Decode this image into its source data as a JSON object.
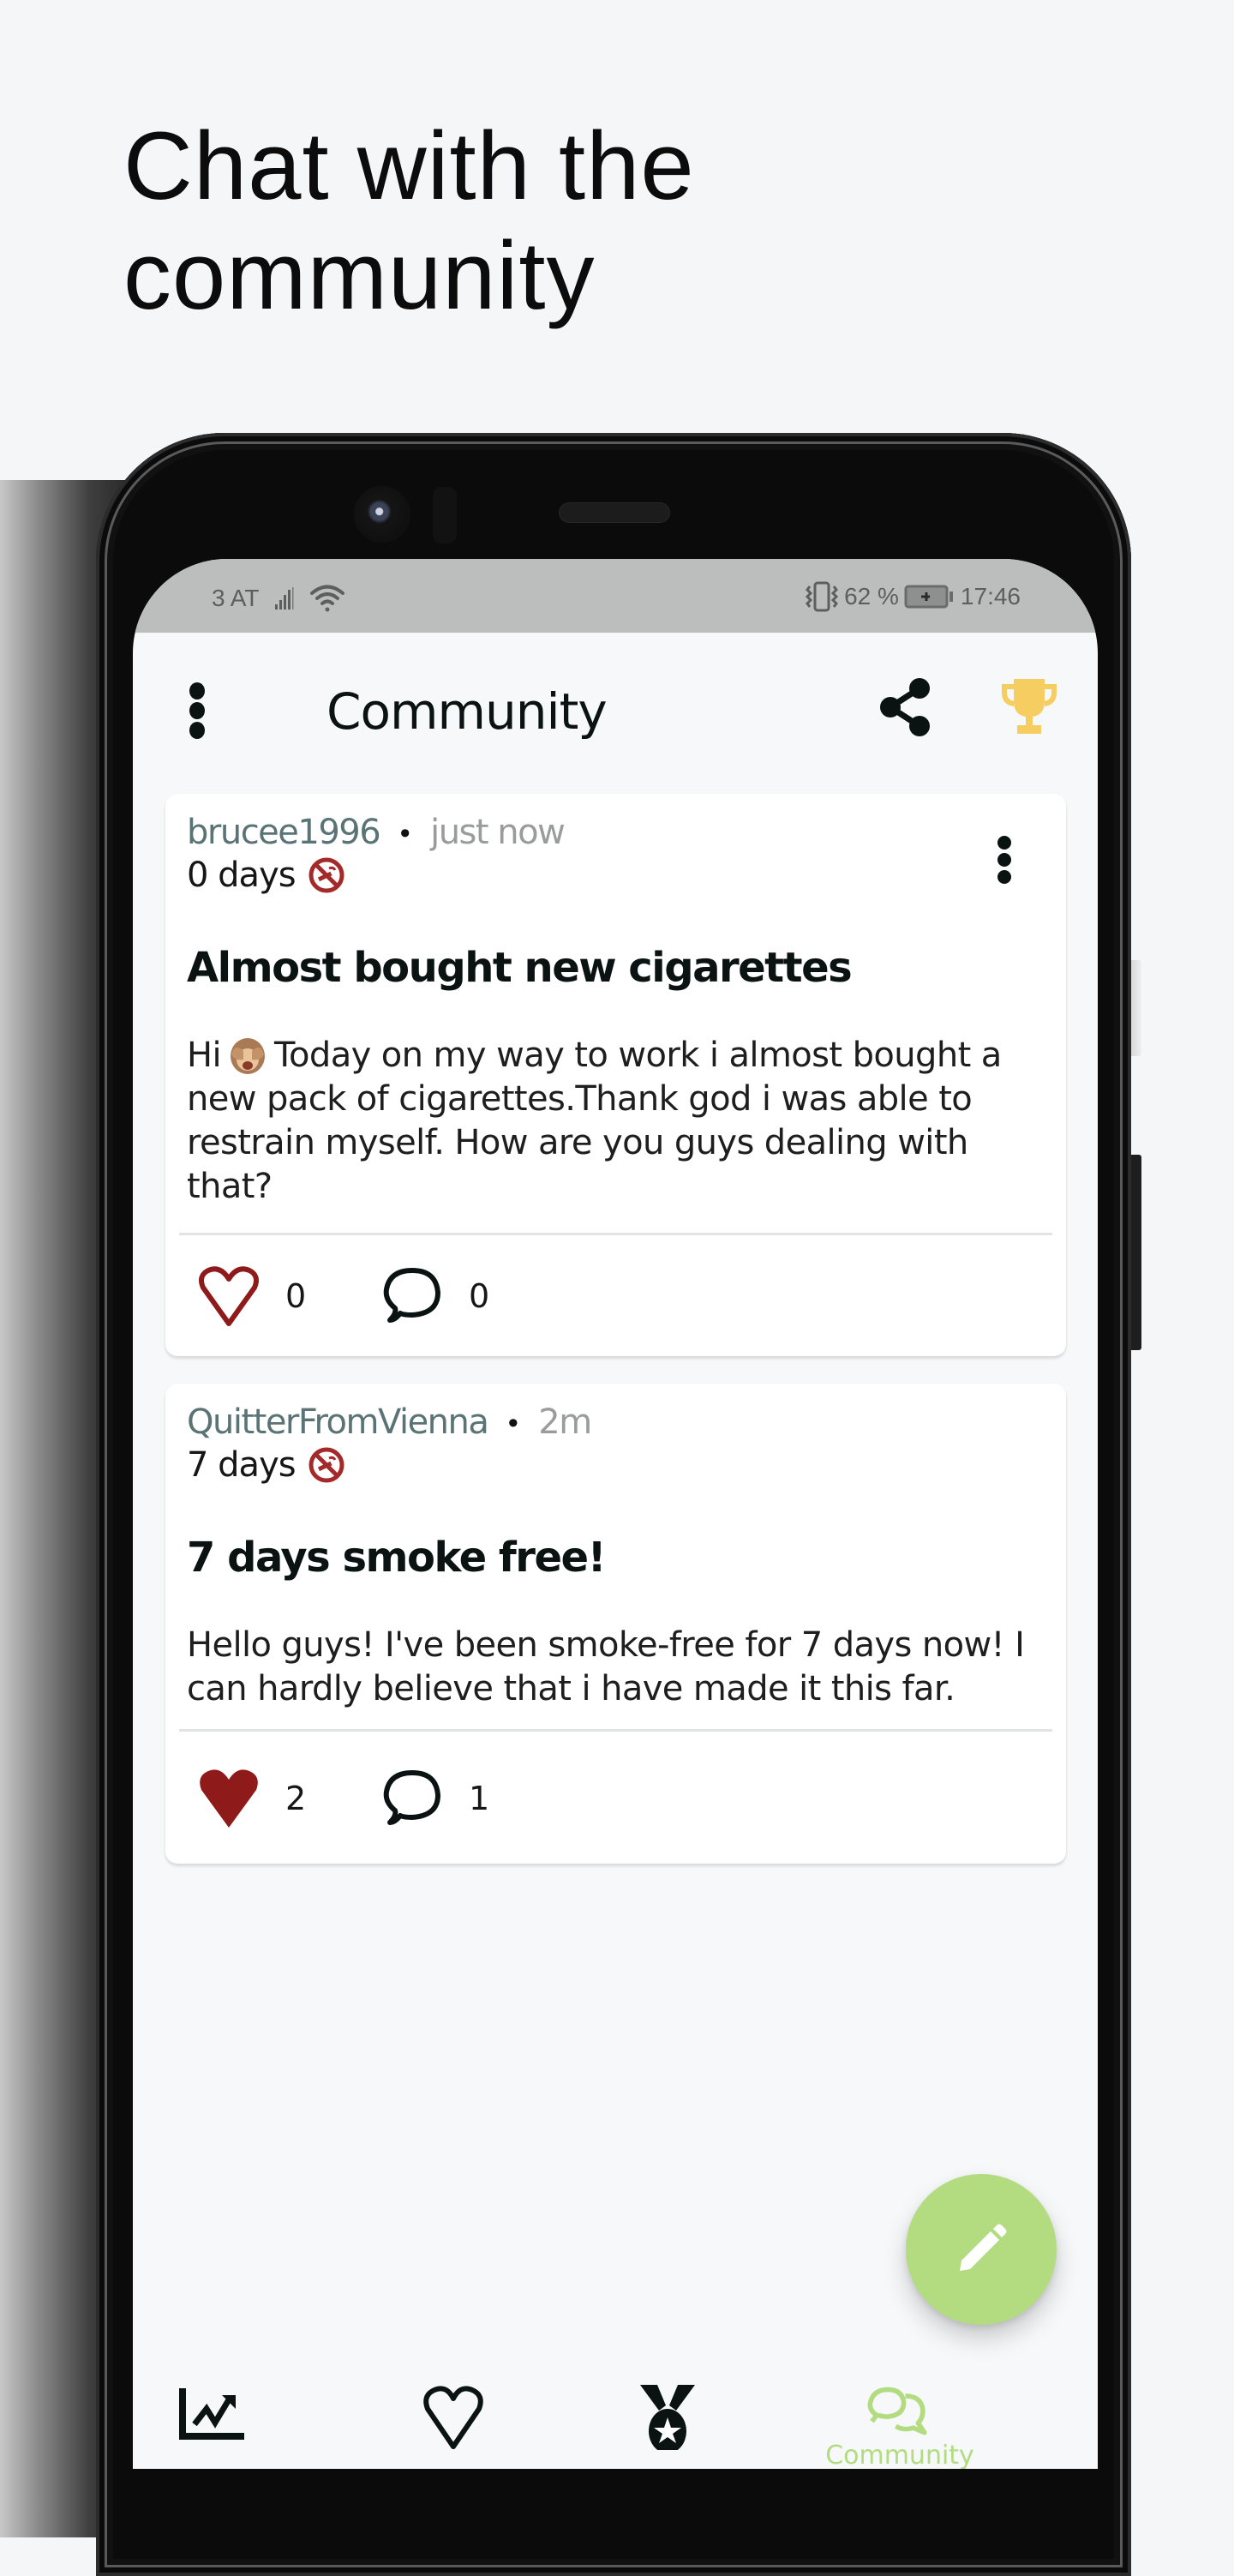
{
  "headline": "Chat with the\ncommunity",
  "status_bar": {
    "carrier": "3 AT",
    "battery_percent": "62 %",
    "time": "17:46",
    "icons": [
      "signal-icon",
      "wifi-icon",
      "vibrate-icon",
      "battery-charging-icon"
    ]
  },
  "app_bar": {
    "title": "Community",
    "left_icon": "more-vertical-icon",
    "right_icons": [
      "share-icon",
      "trophy-icon"
    ]
  },
  "posts": [
    {
      "username": "brucee1996",
      "separator": "•",
      "time_ago": "just now",
      "days_smoke_free": "0 days",
      "title": "Almost bought new cigarettes",
      "body_before_emoji": "Hi",
      "emoji": "see-no-evil-monkey",
      "body_after_emoji": "Today on my way to work i almost bought a new pack of cigarettes.Thank god i was able to restrain myself. How are you guys dealing with that?",
      "likes": "0",
      "liked": false,
      "comments": "0",
      "has_menu": true
    },
    {
      "username": "QuitterFromVienna",
      "separator": "•",
      "time_ago": "2m",
      "days_smoke_free": "7 days",
      "title": "7 days smoke free!",
      "body": "Hello guys! I've been smoke-free for 7 days now! I can hardly believe that i have made it this far.",
      "likes": "2",
      "liked": true,
      "comments": "1",
      "has_menu": false
    }
  ],
  "fab": {
    "icon": "pencil-icon",
    "action": "new post"
  },
  "bottom_nav": {
    "items": [
      {
        "icon": "chart-trending-up-icon",
        "active": false
      },
      {
        "icon": "heart-outline-icon",
        "active": false
      },
      {
        "icon": "medal-icon",
        "active": false
      },
      {
        "icon": "chat-bubbles-icon",
        "label": "Community",
        "active": true
      }
    ]
  },
  "colors": {
    "accent_green": "#b3dc80",
    "like_red": "#8e1a1a",
    "trophy_gold": "#f6cd60",
    "username": "#5a7476",
    "timestamp": "#9a9c9c",
    "status_bar_bg": "#bcbebd"
  }
}
